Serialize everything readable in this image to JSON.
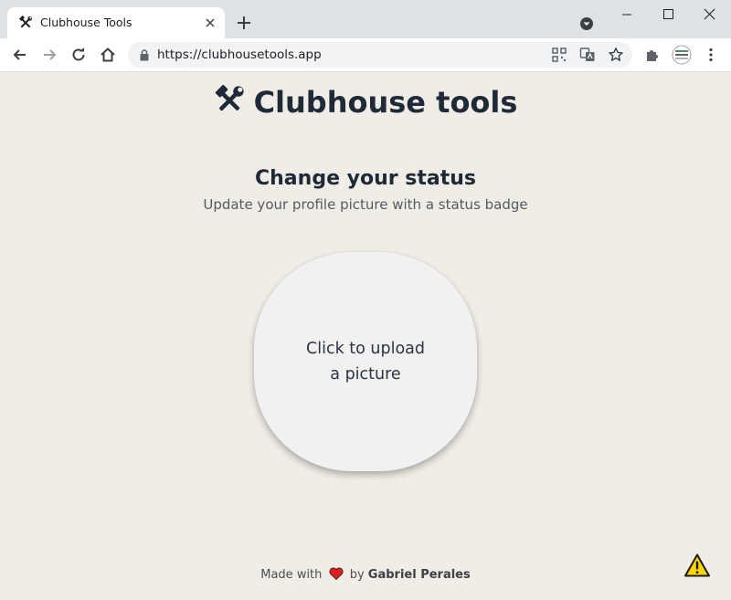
{
  "browser": {
    "tab": {
      "title": "Clubhouse Tools"
    },
    "address_bar": {
      "url": "https://clubhousetools.app"
    }
  },
  "page": {
    "brand_title": "Clubhouse tools",
    "heading": "Change your status",
    "subheading": "Update your profile picture with a status badge",
    "upload": {
      "line1": "Click to upload",
      "line2": "a picture"
    },
    "footer": {
      "made_with": "Made with",
      "by": "by",
      "author": "Gabriel Perales"
    }
  },
  "icons": {
    "tab_favicon": "hammer-wrench-icon",
    "brand": "hammer-wrench-icon",
    "footer_heart": "heart-icon",
    "warning": "warning-icon"
  },
  "colors": {
    "page_background": "#f0ede6",
    "title_text": "#1f2a38",
    "heart": "#e0201f",
    "warning_fill": "#ffd400"
  }
}
